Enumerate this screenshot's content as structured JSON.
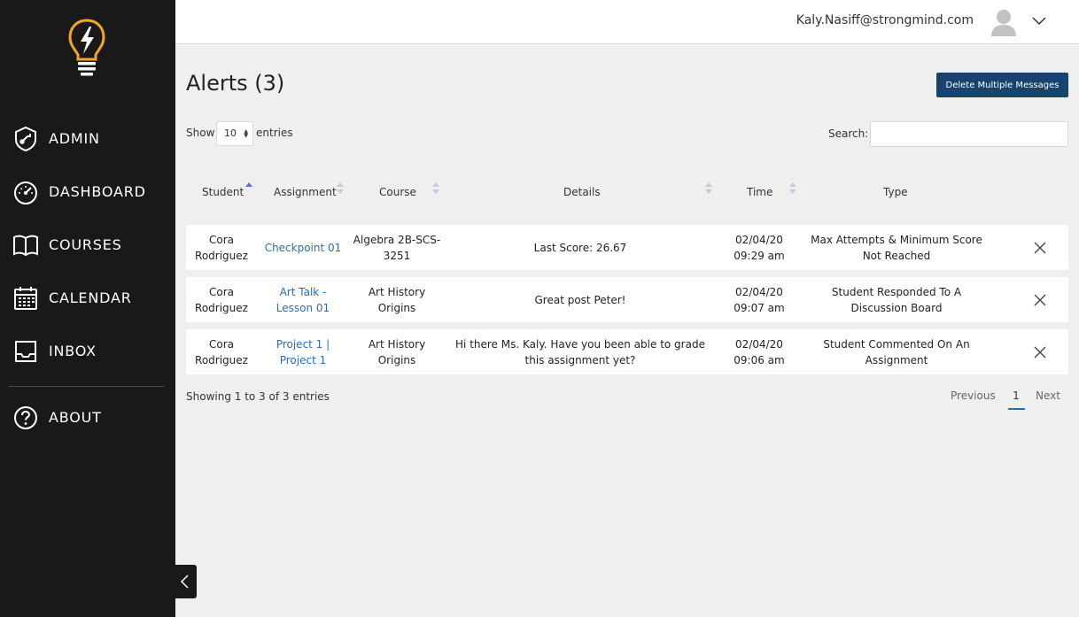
{
  "sidebar": {
    "items": [
      {
        "label": "ADMIN",
        "icon": "admin-shield-icon"
      },
      {
        "label": "DASHBOARD",
        "icon": "dashboard-gauge-icon"
      },
      {
        "label": "COURSES",
        "icon": "book-icon"
      },
      {
        "label": "CALENDAR",
        "icon": "calendar-icon"
      },
      {
        "label": "INBOX",
        "icon": "inbox-icon"
      },
      {
        "label": "ABOUT",
        "icon": "question-icon"
      }
    ],
    "accent_color": "#f5a623"
  },
  "header": {
    "user_email": "Kaly.Nasiff@strongmind.com"
  },
  "main": {
    "title": "Alerts (3)",
    "delete_button_label": "Delete Multiple Messages",
    "show_label": "Show",
    "entries_value": "10",
    "entries_label": "entries",
    "search_label": "Search:",
    "search_value": "",
    "columns": [
      "Student",
      "Assignment",
      "Course",
      "Details",
      "Time",
      "Type"
    ],
    "rows": [
      {
        "student": "Cora Rodriguez",
        "assignment": "Checkpoint 01",
        "course": "Algebra 2B-SCS-3251",
        "details": "Last Score: 26.67",
        "time": "02/04/20 09:29 am",
        "type": "Max Attempts & Minimum Score Not Reached"
      },
      {
        "student": "Cora Rodriguez",
        "assignment": "Art Talk - Lesson 01",
        "course": "Art History Origins",
        "details": "Great post Peter!",
        "time": "02/04/20 09:07 am",
        "type": "Student Responded To A Discussion Board"
      },
      {
        "student": "Cora Rodriguez",
        "assignment": "Project 1 | Project 1",
        "course": "Art History Origins",
        "details": "Hi there Ms. Kaly. Have you been able to grade this assignment yet?",
        "time": "02/04/20 09:06 am",
        "type": "Student Commented On An Assignment"
      }
    ],
    "showing_info": "Showing 1 to 3 of 3 entries",
    "pagination": {
      "previous": "Previous",
      "current": "1",
      "next": "Next"
    },
    "primary_color": "#16446f",
    "link_color": "#2a6db5"
  }
}
